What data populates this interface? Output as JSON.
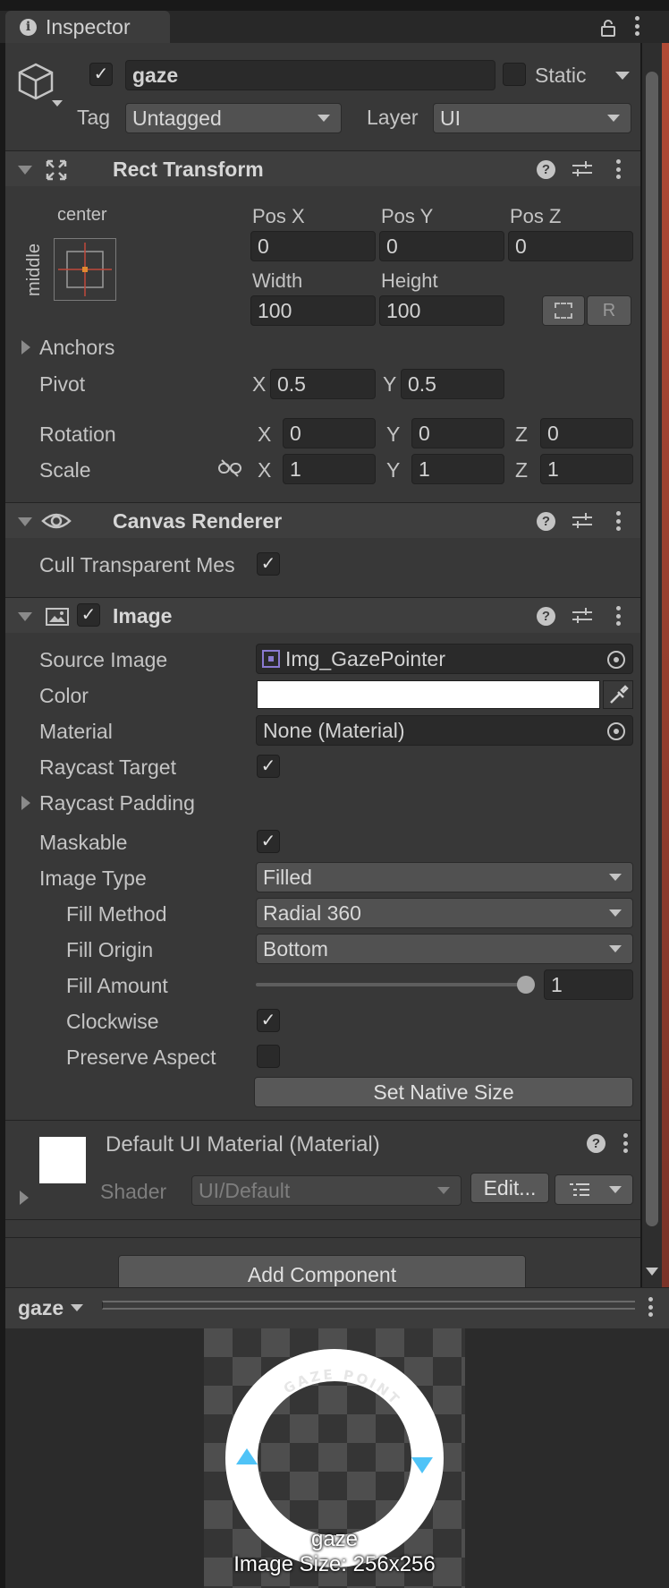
{
  "window": {
    "tab_title": "Inspector"
  },
  "gameobject": {
    "name": "gaze",
    "active": true,
    "static_label": "Static",
    "static_checked": false,
    "tag_label": "Tag",
    "tag_value": "Untagged",
    "layer_label": "Layer",
    "layer_value": "UI"
  },
  "rect_transform": {
    "title": "Rect Transform",
    "anchor_preset_top": "center",
    "anchor_preset_side": "middle",
    "pos_x_label": "Pos X",
    "pos_y_label": "Pos Y",
    "pos_z_label": "Pos Z",
    "pos_x": "0",
    "pos_y": "0",
    "pos_z": "0",
    "width_label": "Width",
    "height_label": "Height",
    "width": "100",
    "height": "100",
    "r_button": "R",
    "anchors_label": "Anchors",
    "pivot_label": "Pivot",
    "pivot_x": "0.5",
    "pivot_y": "0.5",
    "rotation_label": "Rotation",
    "rot_x": "0",
    "rot_y": "0",
    "rot_z": "0",
    "scale_label": "Scale",
    "scale_x": "1",
    "scale_y": "1",
    "scale_z": "1",
    "x": "X",
    "y": "Y",
    "z": "Z"
  },
  "canvas_renderer": {
    "title": "Canvas Renderer",
    "cull_label": "Cull Transparent Mes",
    "cull_checked": true
  },
  "image": {
    "title": "Image",
    "enabled": true,
    "source_image_label": "Source Image",
    "source_image_value": "Img_GazePointer",
    "color_label": "Color",
    "color_value": "#ffffff",
    "material_label": "Material",
    "material_value": "None (Material)",
    "raycast_target_label": "Raycast Target",
    "raycast_target_checked": true,
    "raycast_padding_label": "Raycast Padding",
    "maskable_label": "Maskable",
    "maskable_checked": true,
    "image_type_label": "Image Type",
    "image_type_value": "Filled",
    "fill_method_label": "Fill Method",
    "fill_method_value": "Radial 360",
    "fill_origin_label": "Fill Origin",
    "fill_origin_value": "Bottom",
    "fill_amount_label": "Fill Amount",
    "fill_amount_value": "1",
    "fill_amount_fraction": 1.0,
    "clockwise_label": "Clockwise",
    "clockwise_checked": true,
    "preserve_aspect_label": "Preserve Aspect",
    "preserve_aspect_checked": false,
    "set_native_size": "Set Native Size"
  },
  "material_block": {
    "title": "Default UI Material (Material)",
    "shader_label": "Shader",
    "shader_value": "UI/Default",
    "edit_button": "Edit..."
  },
  "add_component": "Add Component",
  "preview": {
    "object_name": "gaze",
    "caption_name": "gaze",
    "caption_size": "Image Size: 256x256",
    "ring_text": "GAZE POINTER",
    "arrow_color": "#4fc3f7"
  }
}
